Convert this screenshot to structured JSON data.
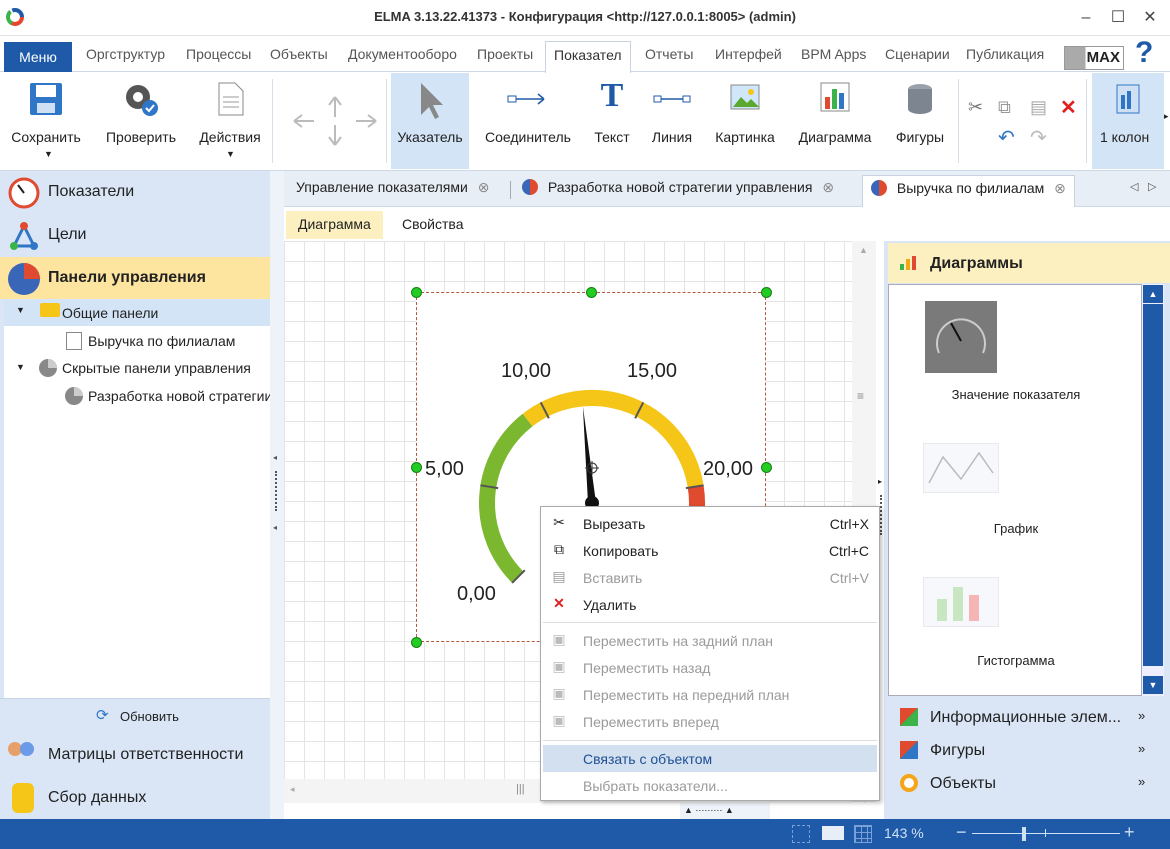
{
  "app": {
    "title": "ELMA 3.13.22.41373 - Конфигурация <http://127.0.0.1:8005> (admin)",
    "minimize": "–",
    "maximize": "☐",
    "close": "✕"
  },
  "menu": {
    "menu_label": "Меню",
    "tabs": [
      "Оргструктур",
      "Процессы",
      "Объекты",
      "Документооборо",
      "Проекты",
      "Показател",
      "Отчеты",
      "Интерфей",
      "BPM Apps",
      "Сценарии",
      "Публикация"
    ],
    "active_tab": "Показател",
    "max_label": "MAX",
    "help": "?"
  },
  "ribbon": {
    "save": "Сохранить",
    "check": "Проверить",
    "actions": "Действия",
    "pointer": "Указатель",
    "connector": "Соединитель",
    "text": "Текст",
    "line": "Линия",
    "picture": "Картинка",
    "diagram": "Диаграмма",
    "shapes": "Фигуры",
    "columns": "1 колон"
  },
  "left": {
    "nav_indicators": "Показатели",
    "nav_goals": "Цели",
    "nav_dashboards": "Панели управления",
    "tree": {
      "common": "Общие панели",
      "revenue": "Выручка по филиалам",
      "hidden": "Скрытые панели управления",
      "strategy": "Разработка новой стратегии"
    },
    "refresh": "Обновить",
    "nav_matrices": "Матрицы ответственности",
    "nav_data": "Сбор данных"
  },
  "doc_tabs": [
    {
      "label": "Управление показателями"
    },
    {
      "label": "Разработка новой стратегии управления"
    },
    {
      "label": "Выручка по филиалам"
    }
  ],
  "sub_tabs": {
    "diagram": "Диаграмма",
    "properties": "Свойства"
  },
  "gauge": {
    "labels": [
      "0,00",
      "5,00",
      "10,00",
      "15,00",
      "20,00"
    ],
    "min": 0,
    "max": 25,
    "value": 12,
    "colors": {
      "low": "#7cb82f",
      "mid": "#f5c518",
      "high": "#e04a2f"
    }
  },
  "right_panel": {
    "header": "Диаграммы",
    "items": [
      "Значение показателя",
      "График",
      "Гистограмма"
    ],
    "sections": [
      "Информационные элем...",
      "Фигуры",
      "Объекты"
    ]
  },
  "context_menu": {
    "items": [
      {
        "label": "Вырезать",
        "shortcut": "Ctrl+X",
        "enabled": true,
        "icon": "scissors-icon"
      },
      {
        "label": "Копировать",
        "shortcut": "Ctrl+C",
        "enabled": true,
        "icon": "copy-icon"
      },
      {
        "label": "Вставить",
        "shortcut": "Ctrl+V",
        "enabled": false,
        "icon": "paste-icon"
      },
      {
        "label": "Удалить",
        "shortcut": "",
        "enabled": true,
        "icon": "delete-icon"
      },
      {
        "label": "Переместить на задний план",
        "shortcut": "",
        "enabled": false,
        "icon": "send-to-back-icon"
      },
      {
        "label": "Переместить назад",
        "shortcut": "",
        "enabled": false,
        "icon": "send-backward-icon"
      },
      {
        "label": "Переместить на передний план",
        "shortcut": "",
        "enabled": false,
        "icon": "bring-to-front-icon"
      },
      {
        "label": "Переместить вперед",
        "shortcut": "",
        "enabled": false,
        "icon": "bring-forward-icon"
      },
      {
        "label": "Связать с объектом",
        "shortcut": "",
        "enabled": true,
        "icon": ""
      },
      {
        "label": "Выбрать показатели...",
        "shortcut": "",
        "enabled": false,
        "icon": ""
      }
    ]
  },
  "status": {
    "zoom": "143 %"
  }
}
